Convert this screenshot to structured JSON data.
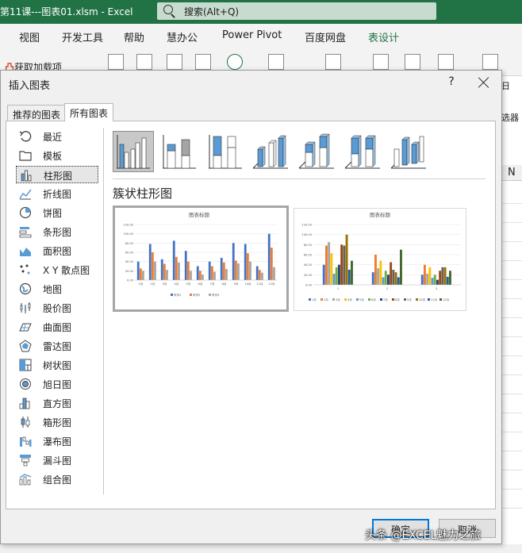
{
  "excel": {
    "title": "第11课---图表01.xlsm  -  Excel",
    "search_placeholder": "搜索(Alt+Q)",
    "ribbon_tabs": [
      "视图",
      "开发工具",
      "帮助",
      "慧办公",
      "Power Pivot",
      "百度网盘",
      "表设计"
    ],
    "addin_label": "获取加载项",
    "right_labels": {
      "ri": "日",
      "filter": "选器",
      "column_n": "N"
    }
  },
  "dialog": {
    "title": "插入图表",
    "help": "?",
    "tabs": [
      "推荐的图表",
      "所有图表"
    ],
    "active_tab": "所有图表",
    "categories": [
      {
        "label": "最近",
        "icon": "undo-icon"
      },
      {
        "label": "模板",
        "icon": "folder-icon"
      },
      {
        "label": "柱形图",
        "icon": "column-chart-icon"
      },
      {
        "label": "折线图",
        "icon": "line-chart-icon"
      },
      {
        "label": "饼图",
        "icon": "pie-chart-icon"
      },
      {
        "label": "条形图",
        "icon": "bar-chart-icon"
      },
      {
        "label": "面积图",
        "icon": "area-chart-icon"
      },
      {
        "label": "X Y 散点图",
        "icon": "scatter-chart-icon"
      },
      {
        "label": "地图",
        "icon": "map-chart-icon"
      },
      {
        "label": "股价图",
        "icon": "stock-chart-icon"
      },
      {
        "label": "曲面图",
        "icon": "surface-chart-icon"
      },
      {
        "label": "雷达图",
        "icon": "radar-chart-icon"
      },
      {
        "label": "树状图",
        "icon": "treemap-chart-icon"
      },
      {
        "label": "旭日图",
        "icon": "sunburst-chart-icon"
      },
      {
        "label": "直方图",
        "icon": "histogram-chart-icon"
      },
      {
        "label": "箱形图",
        "icon": "box-whisker-chart-icon"
      },
      {
        "label": "瀑布图",
        "icon": "waterfall-chart-icon"
      },
      {
        "label": "漏斗图",
        "icon": "funnel-chart-icon"
      },
      {
        "label": "组合图",
        "icon": "combo-chart-icon"
      }
    ],
    "selected_category": "柱形图",
    "subtypes": [
      "clustered-column",
      "stacked-column",
      "100-stacked-column",
      "3d-clustered-column",
      "3d-stacked-column",
      "3d-100-stacked-column",
      "3d-column"
    ],
    "selected_subtype": "clustered-column",
    "chart_type_title": "簇状柱形图",
    "ok": "确定",
    "cancel": "取消"
  },
  "colors": {
    "blue": "#4472c4",
    "orange": "#ed7d31",
    "gray": "#a5a5a5",
    "excel_green": "#217346"
  },
  "chart_data": [
    {
      "type": "bar",
      "title": "图表标题",
      "categories": [
        "1月",
        "2月",
        "3月",
        "4月",
        "5月",
        "6月",
        "7月",
        "8月",
        "9月",
        "10月",
        "11月",
        "12月"
      ],
      "series": [
        {
          "name": "系列1",
          "values": [
            40,
            78,
            45,
            85,
            63,
            30,
            40,
            48,
            80,
            78,
            30,
            100
          ]
        },
        {
          "name": "系列2",
          "values": [
            25,
            60,
            35,
            50,
            40,
            20,
            30,
            38,
            42,
            58,
            22,
            70
          ]
        },
        {
          "name": "系列3",
          "values": [
            20,
            40,
            22,
            38,
            20,
            12,
            18,
            24,
            36,
            40,
            16,
            28
          ]
        }
      ],
      "yticks": [
        "0.00",
        "20.00",
        "40.00",
        "60.00",
        "80.00",
        "100.00",
        "120.00"
      ],
      "ylim": [
        0,
        120
      ],
      "legend": "bottom"
    },
    {
      "type": "bar",
      "title": "图表标题",
      "categories": [
        "1",
        "2",
        "3"
      ],
      "series": [
        {
          "name": "1月",
          "values": [
            40,
            25,
            20
          ]
        },
        {
          "name": "2月",
          "values": [
            78,
            60,
            40
          ]
        },
        {
          "name": "3月",
          "values": [
            85,
            33,
            22
          ]
        },
        {
          "name": "4月",
          "values": [
            63,
            48,
            35
          ]
        },
        {
          "name": "5月",
          "values": [
            22,
            15,
            14
          ]
        },
        {
          "name": "6月",
          "values": [
            35,
            28,
            20
          ]
        },
        {
          "name": "7月",
          "values": [
            40,
            20,
            10
          ]
        },
        {
          "name": "8月",
          "values": [
            80,
            45,
            28
          ]
        },
        {
          "name": "9月",
          "values": [
            78,
            30,
            35
          ]
        },
        {
          "name": "10月",
          "values": [
            100,
            25,
            35
          ]
        },
        {
          "name": "11月",
          "values": [
            30,
            15,
            16
          ]
        },
        {
          "name": "12月",
          "values": [
            48,
            70,
            28
          ]
        }
      ],
      "yticks": [
        "0.00",
        "20.00",
        "40.00",
        "60.00",
        "80.00",
        "100.00",
        "120.00"
      ],
      "ylim": [
        0,
        120
      ],
      "legend": "bottom"
    }
  ],
  "watermark": "头条 @EXCEL魅力之旅"
}
